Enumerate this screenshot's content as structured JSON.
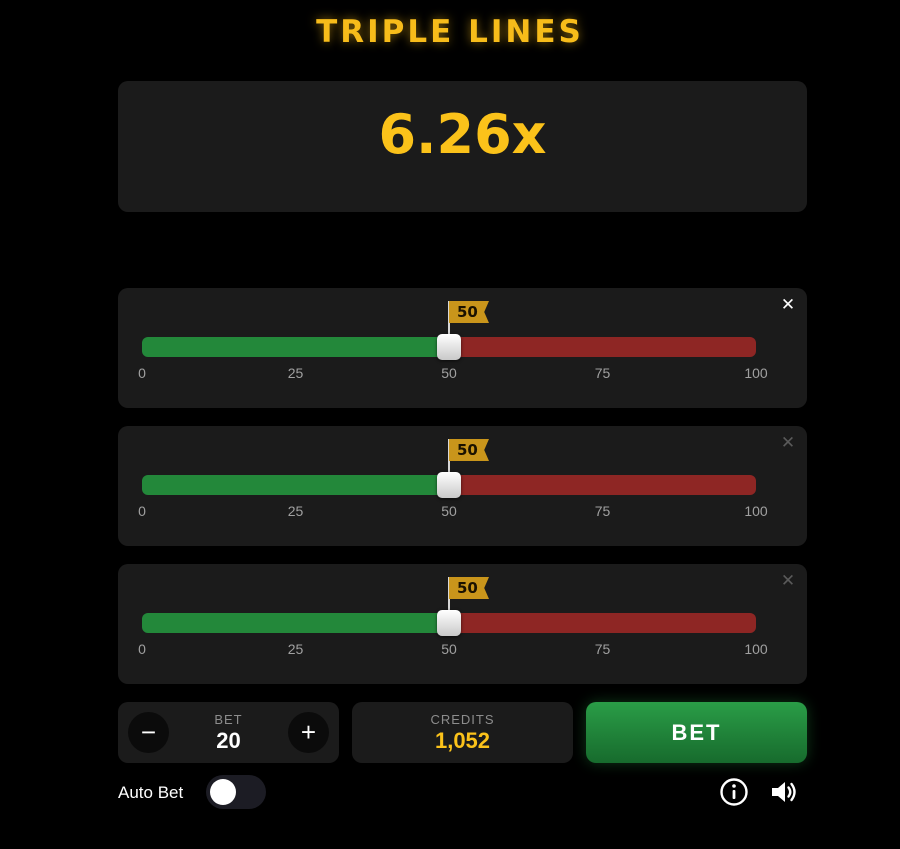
{
  "header": {
    "title": "TRIPLE LINES"
  },
  "multiplier": {
    "value": "6.26x"
  },
  "lines": [
    {
      "marker_value": 50,
      "marker_label": "50",
      "ticks": [
        "0",
        "25",
        "50",
        "75",
        "100"
      ],
      "close_icon": "close-icon",
      "close_active": true
    },
    {
      "marker_value": 50,
      "marker_label": "50",
      "ticks": [
        "0",
        "25",
        "50",
        "75",
        "100"
      ],
      "close_icon": "close-icon",
      "close_active": false
    },
    {
      "marker_value": 50,
      "marker_label": "50",
      "ticks": [
        "0",
        "25",
        "50",
        "75",
        "100"
      ],
      "close_icon": "close-icon",
      "close_active": false
    }
  ],
  "bet": {
    "label": "BET",
    "value": "20",
    "decrease_symbol": "−",
    "increase_symbol": "+"
  },
  "credits": {
    "label": "CREDITS",
    "value": "1,052"
  },
  "bet_button": {
    "label": "BET"
  },
  "auto_bet": {
    "label": "Auto Bet",
    "enabled": false
  },
  "icons": {
    "info": "info-icon",
    "sound": "speaker-icon"
  },
  "colors": {
    "accent_gold": "#fbc21a",
    "track_win": "#23883a",
    "track_lose": "#8e2624",
    "bet_button": "#2a9d47",
    "panel": "#1b1b1b"
  }
}
